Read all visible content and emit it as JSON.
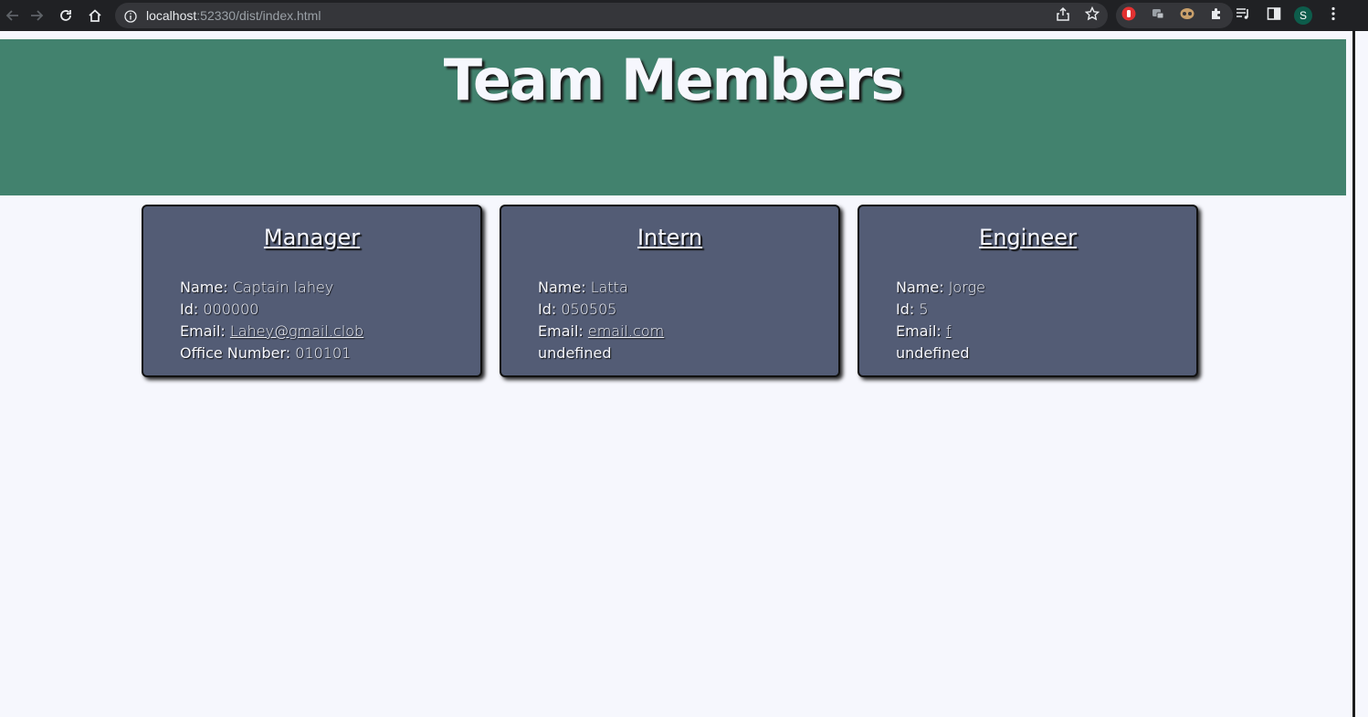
{
  "browser": {
    "url_host": "localhost",
    "url_rest": ":52330/dist/index.html",
    "profile_initial": "S"
  },
  "page": {
    "title": "Team Members"
  },
  "cards": [
    {
      "role": "Manager",
      "name_label": "Name:",
      "name": "Captain lahey",
      "id_label": "Id:",
      "id": "000000",
      "email_label": "Email:",
      "email": "Lahey@gmail.clob",
      "extra_label": "Office Number:",
      "extra": "010101"
    },
    {
      "role": "Intern",
      "name_label": "Name:",
      "name": "Latta",
      "id_label": "Id:",
      "id": "050505",
      "email_label": "Email:",
      "email": "email.com",
      "extra": "undefined"
    },
    {
      "role": "Engineer",
      "name_label": "Name:",
      "name": "Jorge",
      "id_label": "Id:",
      "id": "5",
      "email_label": "Email:",
      "email": "f",
      "extra": "undefined"
    }
  ],
  "colors": {
    "header_bg": "#42826e",
    "card_bg": "#535c75",
    "page_bg": "#f6f7fd",
    "link": "#f4c28c"
  }
}
